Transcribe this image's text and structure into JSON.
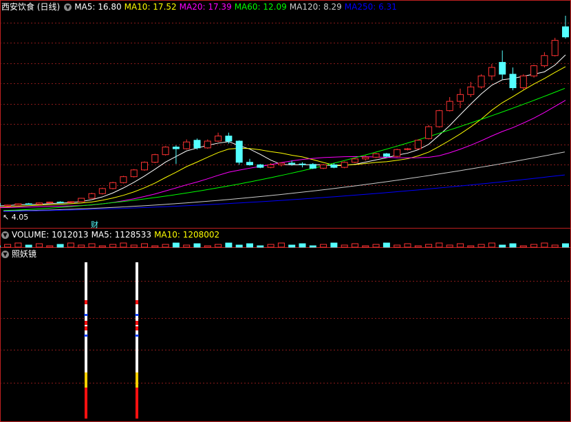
{
  "header": {
    "title": "西安饮食 (日线)",
    "ma": [
      {
        "label": "MA5: 16.80",
        "color": "#ffffff"
      },
      {
        "label": "MA10: 17.52",
        "color": "#ffff00"
      },
      {
        "label": "MA20: 17.39",
        "color": "#ff00ff"
      },
      {
        "label": "MA60: 12.09",
        "color": "#00ff00"
      },
      {
        "label": "MA120: 8.29",
        "color": "#cccccc"
      },
      {
        "label": "MA250: 6.31",
        "color": "#0000ff"
      }
    ]
  },
  "volume_header": {
    "label": "VOLUME: 1012013",
    "ma5": "MA5: 1128533",
    "ma10": "MA10: 1208002"
  },
  "indicator_header": {
    "label": "照妖镜"
  },
  "labels": {
    "price_low": "4.05",
    "marker": "财"
  },
  "colors": {
    "up": "#ff3232",
    "down": "#54ffff",
    "grid": "#8b1a1a",
    "separator": "#c02020"
  },
  "chart_data": {
    "type": "candlestick",
    "title": "西安饮食 (日线)",
    "candles": [
      [
        4.12,
        4.18,
        4.05,
        4.1
      ],
      [
        4.1,
        4.15,
        4.06,
        4.12
      ],
      [
        4.12,
        4.2,
        4.08,
        4.16
      ],
      [
        4.16,
        4.22,
        4.1,
        4.14
      ],
      [
        4.14,
        4.4,
        4.12,
        4.35
      ],
      [
        4.35,
        4.8,
        4.3,
        4.7
      ],
      [
        4.7,
        4.75,
        4.45,
        4.5
      ],
      [
        4.5,
        4.6,
        4.38,
        4.4
      ],
      [
        4.42,
        4.75,
        4.4,
        4.7
      ],
      [
        4.7,
        5.05,
        4.6,
        4.95
      ],
      [
        4.95,
        5.0,
        4.55,
        4.65
      ],
      [
        4.65,
        4.8,
        4.6,
        4.75
      ],
      [
        4.75,
        4.95,
        4.7,
        4.9
      ],
      [
        4.9,
        5.0,
        4.8,
        4.85
      ],
      [
        4.85,
        5.05,
        4.75,
        5.0
      ],
      [
        5.0,
        5.15,
        4.95,
        5.1
      ],
      [
        5.1,
        5.2,
        5.0,
        5.05
      ],
      [
        5.05,
        5.2,
        5.0,
        5.15
      ],
      [
        5.15,
        5.6,
        5.1,
        5.55
      ],
      [
        5.55,
        6.2,
        5.5,
        6.1
      ],
      [
        6.1,
        6.8,
        6.0,
        6.7
      ],
      [
        6.7,
        7.5,
        6.6,
        7.4
      ],
      [
        7.4,
        8.2,
        7.3,
        8.1
      ],
      [
        8.1,
        9.0,
        8.0,
        8.9
      ],
      [
        8.9,
        9.9,
        8.8,
        9.8
      ],
      [
        9.8,
        10.8,
        9.7,
        10.7
      ],
      [
        10.7,
        11.7,
        10.6,
        11.6
      ],
      [
        11.6,
        11.8,
        9.6,
        11.4
      ],
      [
        11.4,
        12.5,
        11.3,
        12.2
      ],
      [
        12.4,
        12.6,
        11.3,
        11.5
      ],
      [
        11.5,
        12.5,
        11.4,
        12.3
      ],
      [
        12.3,
        13.3,
        12.2,
        12.9
      ],
      [
        12.9,
        13.3,
        12.0,
        12.3
      ],
      [
        12.3,
        12.4,
        9.5,
        9.8
      ],
      [
        9.8,
        10.2,
        9.4,
        9.5
      ],
      [
        9.5,
        9.6,
        9.1,
        9.2
      ],
      [
        9.2,
        9.7,
        9.1,
        9.5
      ],
      [
        9.5,
        9.8,
        9.3,
        9.7
      ],
      [
        9.7,
        10.0,
        9.4,
        9.6
      ],
      [
        9.6,
        9.8,
        9.2,
        9.55
      ],
      [
        9.55,
        9.7,
        9.0,
        9.1
      ],
      [
        9.1,
        9.6,
        9.0,
        9.5
      ],
      [
        9.5,
        9.7,
        9.1,
        9.2
      ],
      [
        9.2,
        9.9,
        9.1,
        9.8
      ],
      [
        9.8,
        10.3,
        9.7,
        10.2
      ],
      [
        10.2,
        10.6,
        10.0,
        10.4
      ],
      [
        10.4,
        10.9,
        10.3,
        10.8
      ],
      [
        10.8,
        10.9,
        10.4,
        10.5
      ],
      [
        10.5,
        11.4,
        10.4,
        11.3
      ],
      [
        11.3,
        11.5,
        11.2,
        11.4
      ],
      [
        11.4,
        12.5,
        11.3,
        12.4
      ],
      [
        12.6,
        14.2,
        12.5,
        14.0
      ],
      [
        14.0,
        16.0,
        13.9,
        15.9
      ],
      [
        15.9,
        17.5,
        15.8,
        17.0
      ],
      [
        17.0,
        18.5,
        16.2,
        17.8
      ],
      [
        17.8,
        19.3,
        17.5,
        18.7
      ],
      [
        18.7,
        20.2,
        18.5,
        20.0
      ],
      [
        20.0,
        21.4,
        19.5,
        21.0
      ],
      [
        21.6,
        23.0,
        19.6,
        20.2
      ],
      [
        20.2,
        21.0,
        18.3,
        18.6
      ],
      [
        18.6,
        20.2,
        18.4,
        20.0
      ],
      [
        20.0,
        21.3,
        19.8,
        21.2
      ],
      [
        21.2,
        22.8,
        21.0,
        22.4
      ],
      [
        22.4,
        24.5,
        22.3,
        24.2
      ],
      [
        25.8,
        27.1,
        24.4,
        24.6
      ]
    ],
    "ma_lines": [
      "MA5",
      "MA10",
      "MA20",
      "MA60",
      "MA120",
      "MA250"
    ],
    "volume_last": 1012013,
    "indicator_name": "照妖镜"
  }
}
